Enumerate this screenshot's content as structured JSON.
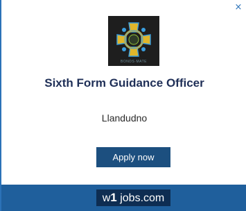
{
  "close_glyph": "×",
  "logo": {
    "icon": "crest-logo-icon",
    "text": "BONDS·MATE"
  },
  "job_title": "Sixth Form Guidance Officer",
  "location": "Llandudno",
  "apply_button": "Apply now",
  "brand": {
    "w": "w",
    "one": "1",
    "domain": "jobs.com"
  },
  "colors": {
    "accent": "#2b72b8",
    "title": "#1f2f57",
    "button": "#1c4f7f",
    "footer": "#1f5f9c",
    "brand_box": "#0e2d52"
  }
}
